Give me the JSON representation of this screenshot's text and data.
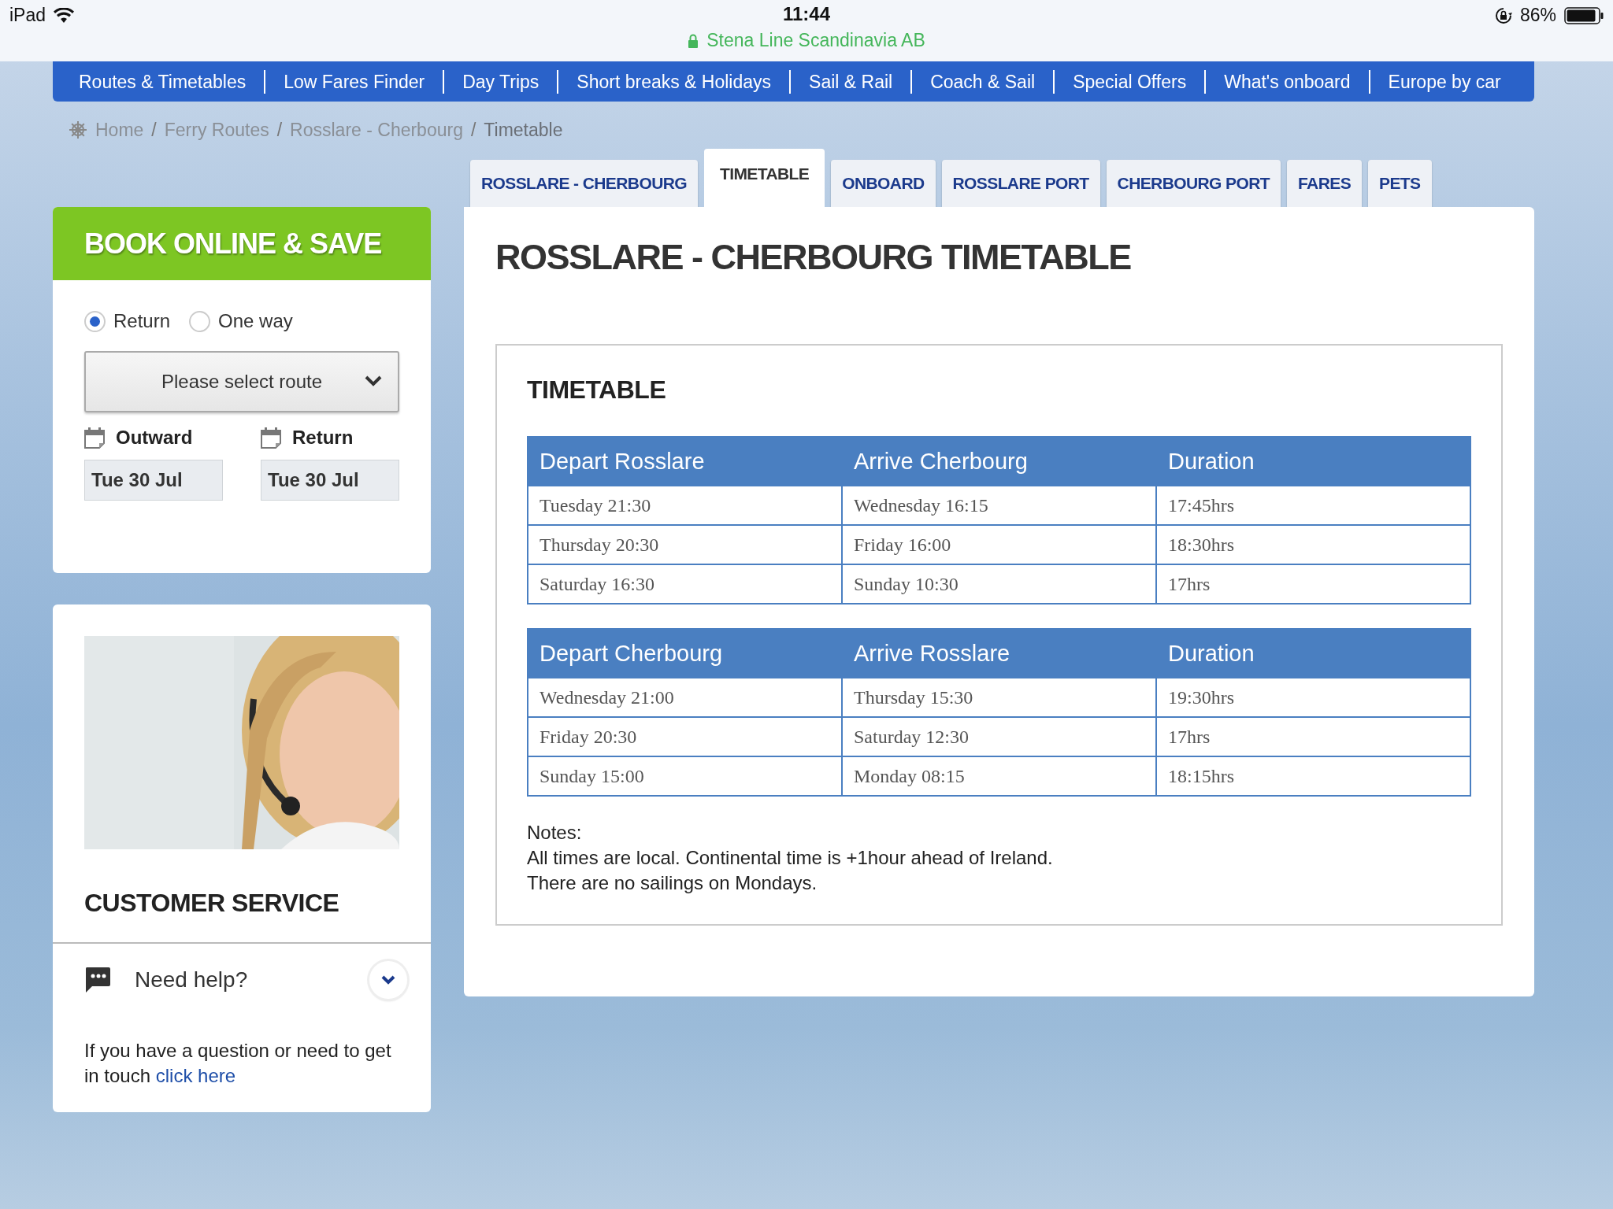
{
  "status_bar": {
    "device": "iPad",
    "time": "11:44",
    "site": "Stena Line Scandinavia AB",
    "battery": "86%"
  },
  "nav": [
    "Routes & Timetables",
    "Low Fares Finder",
    "Day Trips",
    "Short breaks & Holidays",
    "Sail & Rail",
    "Coach & Sail",
    "Special Offers",
    "What's onboard",
    "Europe by car"
  ],
  "breadcrumb": {
    "separator": "/",
    "items": [
      "Home",
      "Ferry Routes",
      "Rosslare - Cherbourg",
      "Timetable"
    ]
  },
  "tabs": [
    {
      "label": "ROSSLARE - CHERBOURG",
      "selected": false
    },
    {
      "label": "TIMETABLE",
      "selected": true
    },
    {
      "label": "ONBOARD",
      "selected": false
    },
    {
      "label": "ROSSLARE PORT",
      "selected": false
    },
    {
      "label": "CHERBOURG PORT",
      "selected": false
    },
    {
      "label": "FARES",
      "selected": false
    },
    {
      "label": "PETS",
      "selected": false
    }
  ],
  "booking": {
    "title": "BOOK ONLINE & SAVE",
    "trip_types": [
      {
        "label": "Return",
        "selected": true
      },
      {
        "label": "One way",
        "selected": false
      }
    ],
    "route_select": "Please select route",
    "dates": [
      {
        "label": "Outward",
        "value": "Tue 30 Jul"
      },
      {
        "label": "Return",
        "value": "Tue 30 Jul"
      }
    ]
  },
  "customer_service": {
    "title": "CUSTOMER SERVICE",
    "help": {
      "label": "Need help?",
      "expanded": false
    },
    "text": "If you have a question or need to get in touch",
    "link": "click here"
  },
  "timetable": {
    "title": "ROSSLARE - CHERBOURG TIMETABLE",
    "heading": "TIMETABLE",
    "tables": [
      {
        "columns": [
          "Depart Rosslare",
          "Arrive Cherbourg",
          "Duration"
        ],
        "rows": [
          [
            "Tuesday 21:30",
            "Wednesday 16:15",
            "17:45hrs"
          ],
          [
            "Thursday 20:30",
            "Friday 16:00",
            "18:30hrs"
          ],
          [
            "Saturday 16:30",
            "Sunday 10:30",
            "17hrs"
          ]
        ]
      },
      {
        "columns": [
          "Depart Cherbourg",
          "Arrive Rosslare",
          "Duration"
        ],
        "rows": [
          [
            "Wednesday 21:00",
            "Thursday 15:30",
            "19:30hrs"
          ],
          [
            "Friday 20:30",
            "Saturday 12:30",
            "17hrs"
          ],
          [
            "Sunday 15:00",
            "Monday 08:15",
            "18:15hrs"
          ]
        ]
      }
    ],
    "notes": [
      "Notes:",
      "All times are local. Continental time is +1hour ahead of Ireland.",
      "There are no sailings on Mondays."
    ]
  }
}
